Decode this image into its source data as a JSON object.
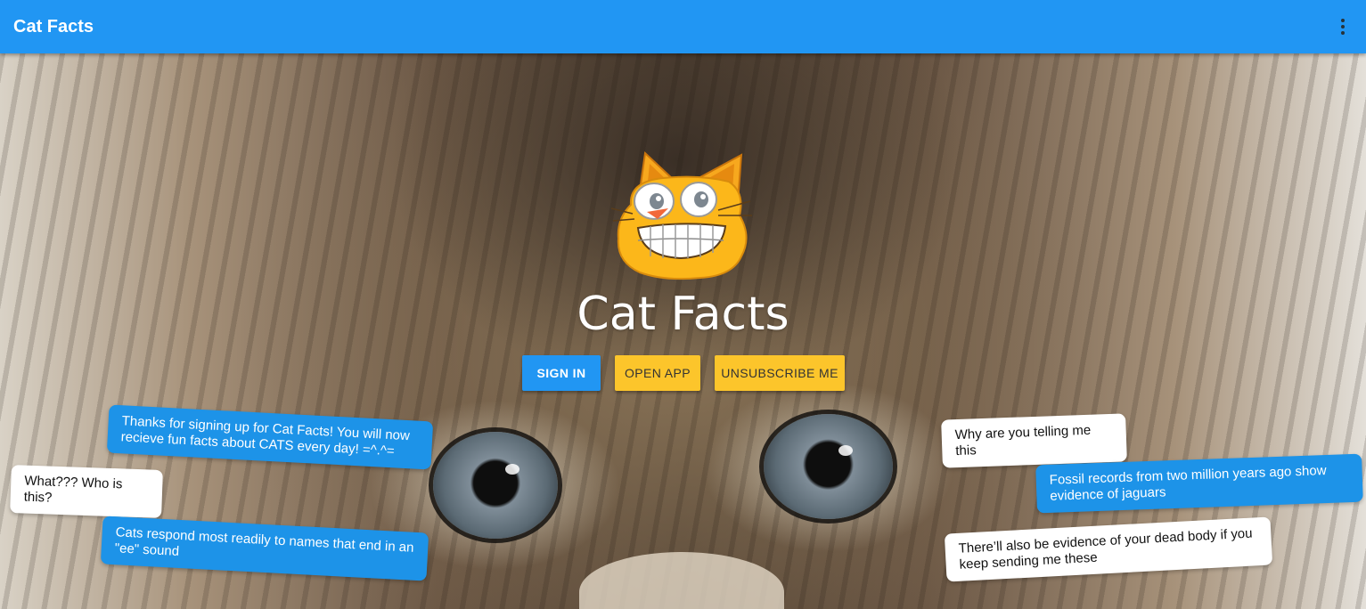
{
  "appbar": {
    "title": "Cat Facts",
    "menu_icon": "more-vert-icon"
  },
  "hero": {
    "title": "Cat Facts",
    "logo_icon": "grinning-cat-logo"
  },
  "buttons": {
    "sign_in": "SIGN IN",
    "open_app": "OPEN APP",
    "unsubscribe": "UNSUBSCRIBE ME"
  },
  "messages": [
    {
      "sender": "catfacts",
      "text": "Thanks for signing up for Cat Facts! You will now recieve fun facts about CATS every day! =^.^="
    },
    {
      "sender": "user",
      "text": "What??? Who is this?"
    },
    {
      "sender": "catfacts",
      "text": "Cats respond most readily to names that end in an \"ee\" sound"
    },
    {
      "sender": "user",
      "text": "Why are you telling me this"
    },
    {
      "sender": "catfacts",
      "text": "Fossil records from two million years ago show evidence of jaguars"
    },
    {
      "sender": "user",
      "text": "There’ll also be evidence of your dead body if you keep sending me these"
    }
  ],
  "colors": {
    "primary": "#2196f3",
    "accent": "#fcc52b",
    "bubble_blue": "#1d93e8",
    "bubble_white": "#ffffff"
  }
}
